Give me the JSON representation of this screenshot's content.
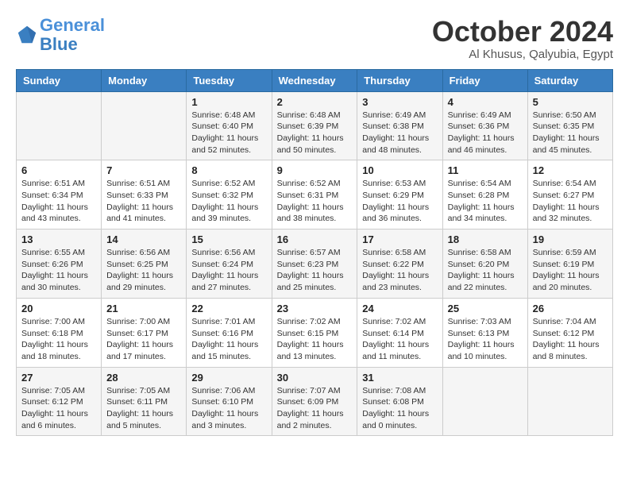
{
  "logo": {
    "line1": "General",
    "line2": "Blue"
  },
  "title": "October 2024",
  "location": "Al Khusus, Qalyubia, Egypt",
  "days_header": [
    "Sunday",
    "Monday",
    "Tuesday",
    "Wednesday",
    "Thursday",
    "Friday",
    "Saturday"
  ],
  "weeks": [
    [
      {
        "day": "",
        "info": ""
      },
      {
        "day": "",
        "info": ""
      },
      {
        "day": "1",
        "info": "Sunrise: 6:48 AM\nSunset: 6:40 PM\nDaylight: 11 hours and 52 minutes."
      },
      {
        "day": "2",
        "info": "Sunrise: 6:48 AM\nSunset: 6:39 PM\nDaylight: 11 hours and 50 minutes."
      },
      {
        "day": "3",
        "info": "Sunrise: 6:49 AM\nSunset: 6:38 PM\nDaylight: 11 hours and 48 minutes."
      },
      {
        "day": "4",
        "info": "Sunrise: 6:49 AM\nSunset: 6:36 PM\nDaylight: 11 hours and 46 minutes."
      },
      {
        "day": "5",
        "info": "Sunrise: 6:50 AM\nSunset: 6:35 PM\nDaylight: 11 hours and 45 minutes."
      }
    ],
    [
      {
        "day": "6",
        "info": "Sunrise: 6:51 AM\nSunset: 6:34 PM\nDaylight: 11 hours and 43 minutes."
      },
      {
        "day": "7",
        "info": "Sunrise: 6:51 AM\nSunset: 6:33 PM\nDaylight: 11 hours and 41 minutes."
      },
      {
        "day": "8",
        "info": "Sunrise: 6:52 AM\nSunset: 6:32 PM\nDaylight: 11 hours and 39 minutes."
      },
      {
        "day": "9",
        "info": "Sunrise: 6:52 AM\nSunset: 6:31 PM\nDaylight: 11 hours and 38 minutes."
      },
      {
        "day": "10",
        "info": "Sunrise: 6:53 AM\nSunset: 6:29 PM\nDaylight: 11 hours and 36 minutes."
      },
      {
        "day": "11",
        "info": "Sunrise: 6:54 AM\nSunset: 6:28 PM\nDaylight: 11 hours and 34 minutes."
      },
      {
        "day": "12",
        "info": "Sunrise: 6:54 AM\nSunset: 6:27 PM\nDaylight: 11 hours and 32 minutes."
      }
    ],
    [
      {
        "day": "13",
        "info": "Sunrise: 6:55 AM\nSunset: 6:26 PM\nDaylight: 11 hours and 30 minutes."
      },
      {
        "day": "14",
        "info": "Sunrise: 6:56 AM\nSunset: 6:25 PM\nDaylight: 11 hours and 29 minutes."
      },
      {
        "day": "15",
        "info": "Sunrise: 6:56 AM\nSunset: 6:24 PM\nDaylight: 11 hours and 27 minutes."
      },
      {
        "day": "16",
        "info": "Sunrise: 6:57 AM\nSunset: 6:23 PM\nDaylight: 11 hours and 25 minutes."
      },
      {
        "day": "17",
        "info": "Sunrise: 6:58 AM\nSunset: 6:22 PM\nDaylight: 11 hours and 23 minutes."
      },
      {
        "day": "18",
        "info": "Sunrise: 6:58 AM\nSunset: 6:20 PM\nDaylight: 11 hours and 22 minutes."
      },
      {
        "day": "19",
        "info": "Sunrise: 6:59 AM\nSunset: 6:19 PM\nDaylight: 11 hours and 20 minutes."
      }
    ],
    [
      {
        "day": "20",
        "info": "Sunrise: 7:00 AM\nSunset: 6:18 PM\nDaylight: 11 hours and 18 minutes."
      },
      {
        "day": "21",
        "info": "Sunrise: 7:00 AM\nSunset: 6:17 PM\nDaylight: 11 hours and 17 minutes."
      },
      {
        "day": "22",
        "info": "Sunrise: 7:01 AM\nSunset: 6:16 PM\nDaylight: 11 hours and 15 minutes."
      },
      {
        "day": "23",
        "info": "Sunrise: 7:02 AM\nSunset: 6:15 PM\nDaylight: 11 hours and 13 minutes."
      },
      {
        "day": "24",
        "info": "Sunrise: 7:02 AM\nSunset: 6:14 PM\nDaylight: 11 hours and 11 minutes."
      },
      {
        "day": "25",
        "info": "Sunrise: 7:03 AM\nSunset: 6:13 PM\nDaylight: 11 hours and 10 minutes."
      },
      {
        "day": "26",
        "info": "Sunrise: 7:04 AM\nSunset: 6:12 PM\nDaylight: 11 hours and 8 minutes."
      }
    ],
    [
      {
        "day": "27",
        "info": "Sunrise: 7:05 AM\nSunset: 6:12 PM\nDaylight: 11 hours and 6 minutes."
      },
      {
        "day": "28",
        "info": "Sunrise: 7:05 AM\nSunset: 6:11 PM\nDaylight: 11 hours and 5 minutes."
      },
      {
        "day": "29",
        "info": "Sunrise: 7:06 AM\nSunset: 6:10 PM\nDaylight: 11 hours and 3 minutes."
      },
      {
        "day": "30",
        "info": "Sunrise: 7:07 AM\nSunset: 6:09 PM\nDaylight: 11 hours and 2 minutes."
      },
      {
        "day": "31",
        "info": "Sunrise: 7:08 AM\nSunset: 6:08 PM\nDaylight: 11 hours and 0 minutes."
      },
      {
        "day": "",
        "info": ""
      },
      {
        "day": "",
        "info": ""
      }
    ]
  ]
}
